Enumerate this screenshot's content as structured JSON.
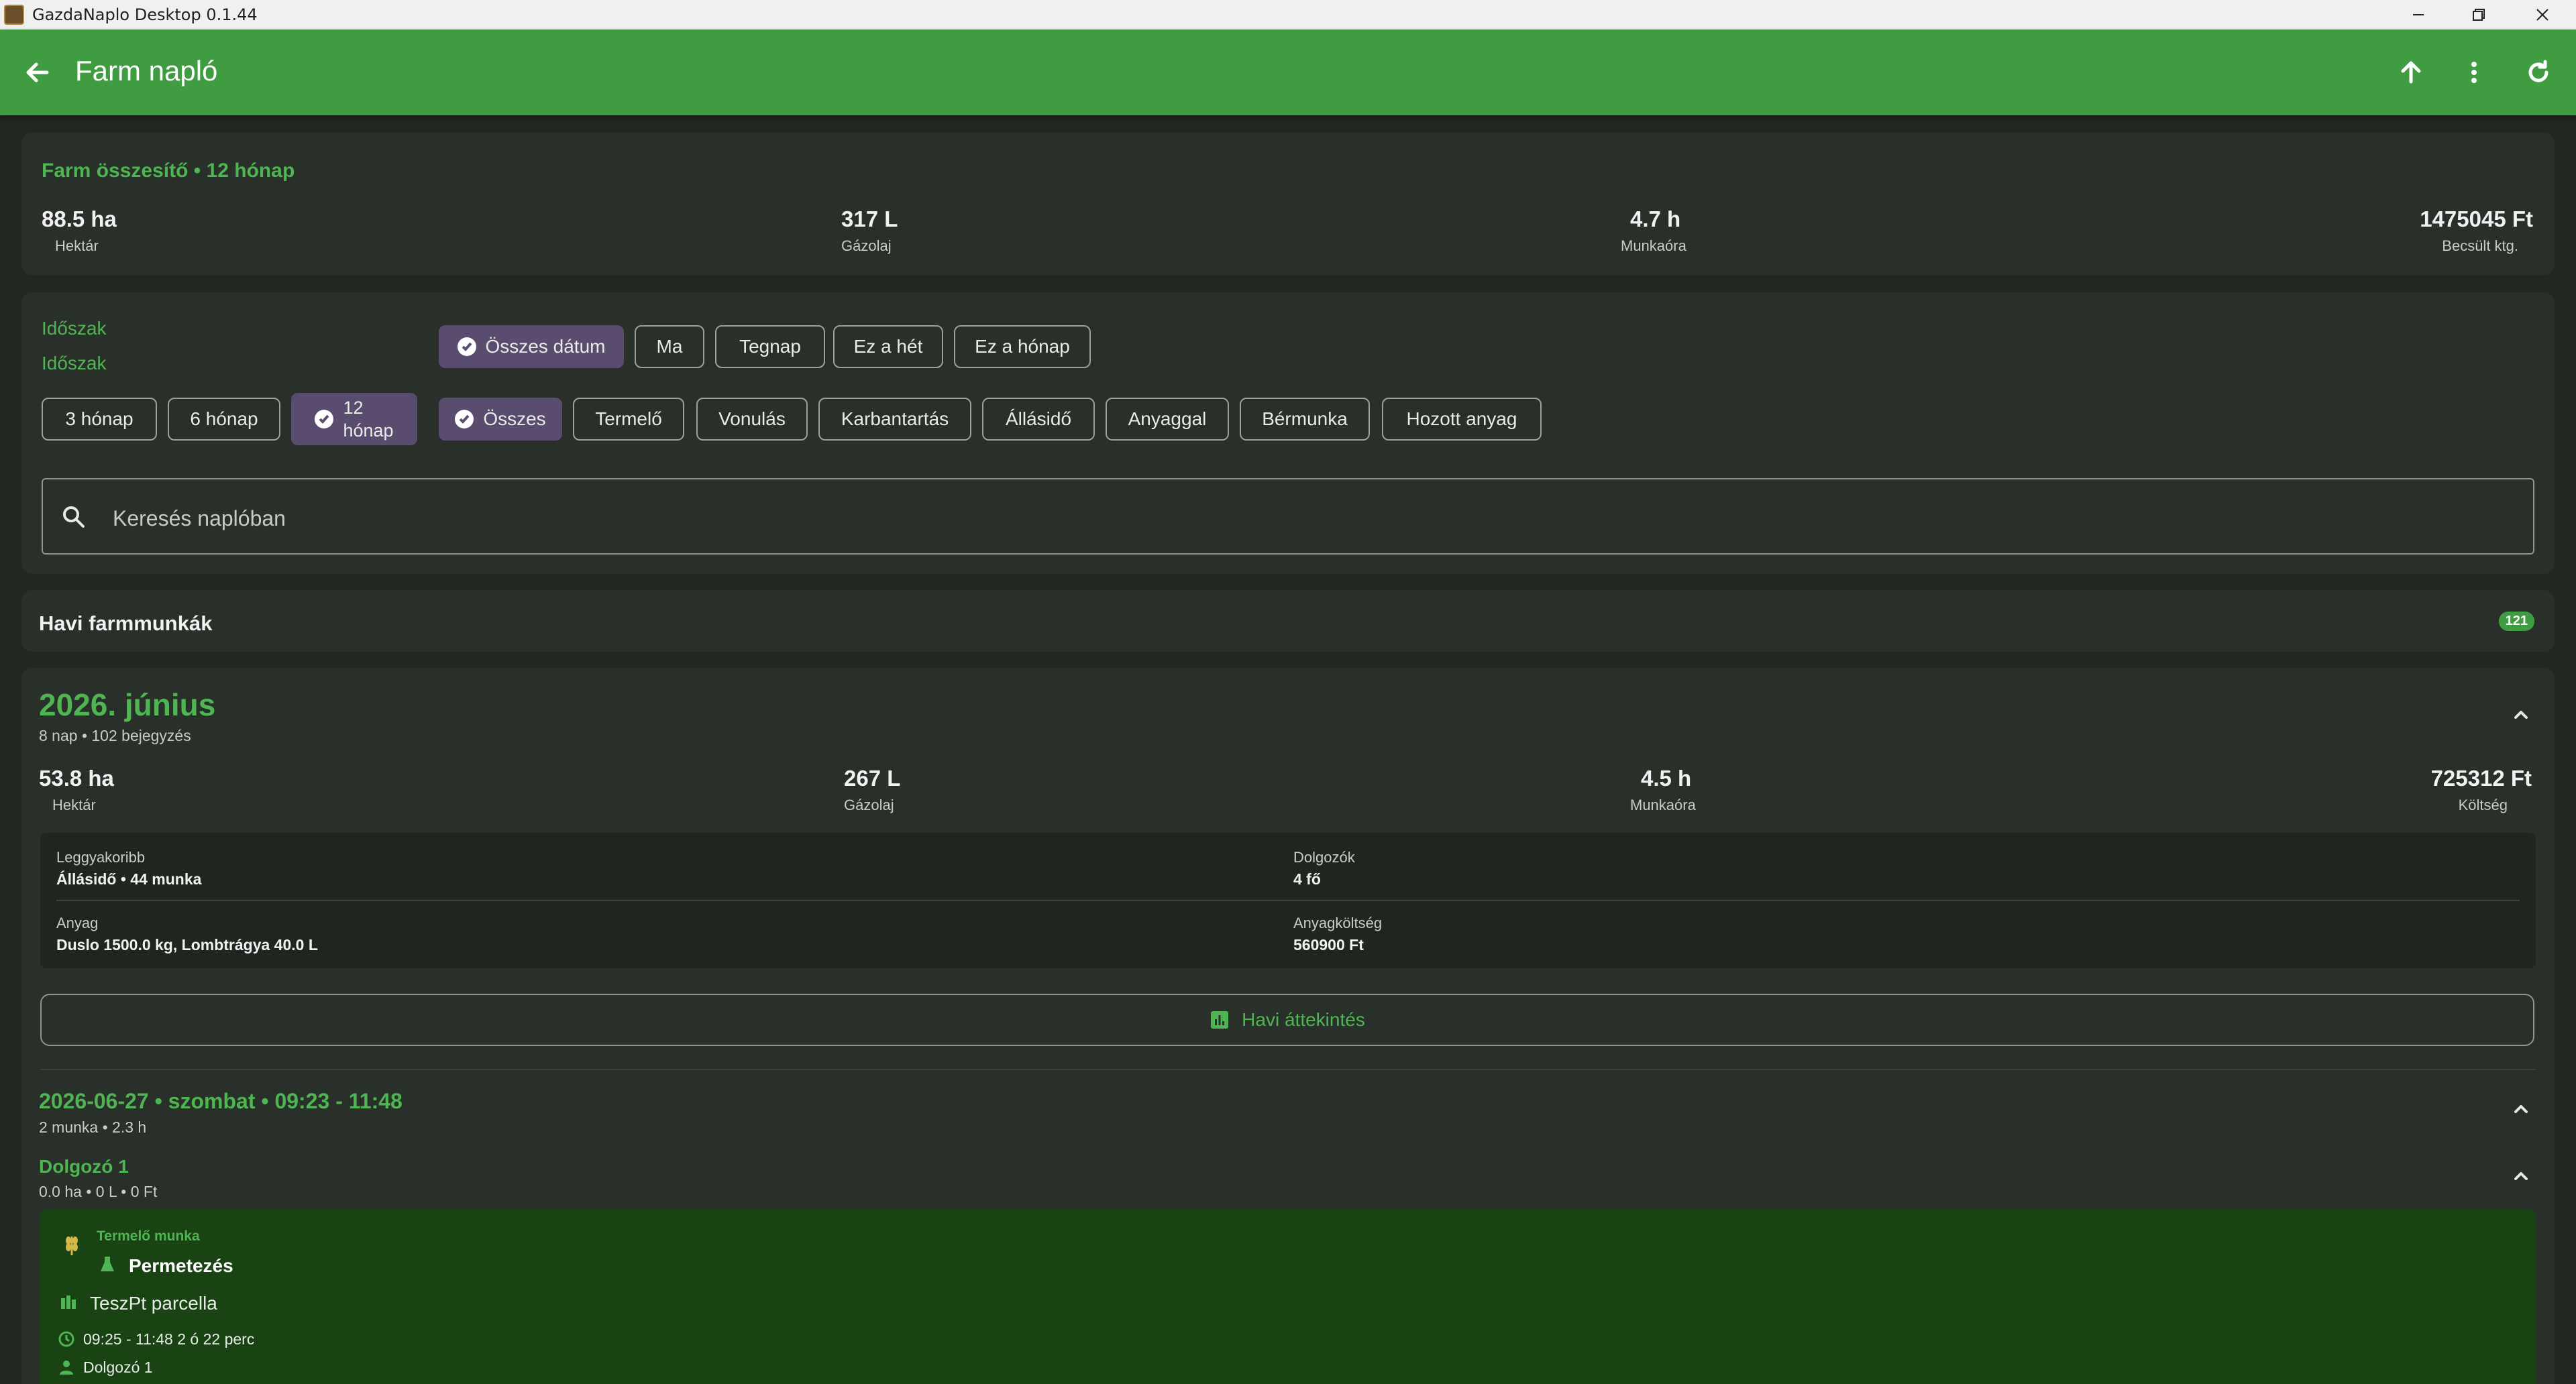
{
  "window": {
    "title": "GazdaNaplo Desktop 0.1.44"
  },
  "appbar": {
    "title": "Farm napló"
  },
  "summary": {
    "title": "Farm összesítő • 12 hónap",
    "stats": [
      {
        "value": "88.5 ha",
        "label": "Hektár"
      },
      {
        "value": "317 L",
        "label": "Gázolaj"
      },
      {
        "value": "4.7 h",
        "label": "Munkaóra"
      },
      {
        "value": "1475045 Ft",
        "label": "Becsült ktg."
      }
    ]
  },
  "filters": {
    "period_label_1": "Időszak",
    "period_label_2": "Időszak",
    "date_chips": [
      "Összes dátum",
      "Ma",
      "Tegnap",
      "Ez a hét",
      "Ez a hónap"
    ],
    "range_chips": [
      "3 hónap",
      "6 hónap",
      "12\nhónap"
    ],
    "type_chips": [
      "Összes",
      "Termelő",
      "Vonulás",
      "Karbantartás",
      "Állásidő",
      "Anyaggal",
      "Bérmunka",
      "Hozott anyag"
    ],
    "search_placeholder": "Keresés naplóban"
  },
  "monthly": {
    "title": "Havi farmmunkák",
    "count": "121"
  },
  "month": {
    "title": "2026. június",
    "subtitle": "8 nap • 102 bejegyzés",
    "stats": [
      {
        "value": "53.8 ha",
        "label": "Hektár"
      },
      {
        "value": "267 L",
        "label": "Gázolaj"
      },
      {
        "value": "4.5 h",
        "label": "Munkaóra"
      },
      {
        "value": "725312 Ft",
        "label": "Költség"
      }
    ],
    "details": {
      "most_common_label": "Leggyakoribb",
      "most_common_value": "Állásidő • 44 munka",
      "workers_label": "Dolgozók",
      "workers_value": "4 fő",
      "material_label": "Anyag",
      "material_value": "Duslo 1500.0 kg, Lombtrágya 40.0 L",
      "material_cost_label": "Anyagköltség",
      "material_cost_value": "560900 Ft"
    },
    "overview_button": "Havi áttekintés"
  },
  "day": {
    "title": "2026-06-27 • szombat • 09:23 - 11:48",
    "subtitle": "2 munka • 2.3 h"
  },
  "worker": {
    "name": "Dolgozó 1",
    "summary": "0.0 ha • 0 L • 0 Ft"
  },
  "entry": {
    "category": "Termelő munka",
    "task": "Permetezés",
    "parcel": "TeszPt parcella",
    "time": "09:25 - 11:48 2 ó 22 perc",
    "worker": "Dolgozó 1"
  },
  "colors": {
    "accent": "#3f9c40",
    "selected_chip": "#5a4c6e",
    "background": "#202820"
  }
}
